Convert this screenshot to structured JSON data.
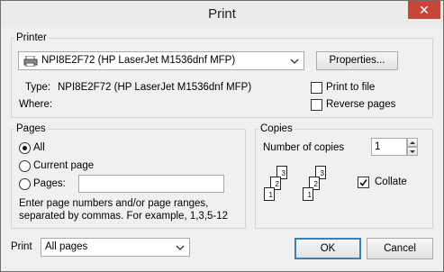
{
  "window": {
    "title": "Print",
    "close_glyph": "✕"
  },
  "printer": {
    "group_label": "Printer",
    "selected": "NPI8E2F72 (HP LaserJet M1536dnf MFP)",
    "properties_label": "Properties...",
    "type_label": "Type:",
    "type_value": "NPI8E2F72 (HP LaserJet M1536dnf MFP)",
    "where_label": "Where:",
    "where_value": "",
    "print_to_file_label": "Print to file",
    "print_to_file_checked": false,
    "reverse_pages_label": "Reverse pages",
    "reverse_pages_checked": false
  },
  "pages": {
    "group_label": "Pages",
    "all_label": "All",
    "current_page_label": "Current page",
    "pages_label": "Pages:",
    "pages_input_value": "",
    "selected_option": "All",
    "hint_line1": "Enter page numbers and/or page ranges,",
    "hint_line2": "separated by commas. For example, 1,3,5-12"
  },
  "copies": {
    "group_label": "Copies",
    "number_label": "Number of copies",
    "number_value": "1",
    "collate_label": "Collate",
    "collate_checked": true,
    "page_numbers": [
      "1",
      "2",
      "3"
    ]
  },
  "footer": {
    "print_label": "Print",
    "print_range_value": "All pages",
    "ok_label": "OK",
    "cancel_label": "Cancel"
  },
  "colors": {
    "close_button": "#c7463a",
    "focus_border": "#3c7fb1"
  },
  "icons": [
    "printer-icon",
    "close-icon",
    "chevron-down-icon",
    "spin-up-icon",
    "spin-down-icon",
    "checkmark-icon"
  ]
}
